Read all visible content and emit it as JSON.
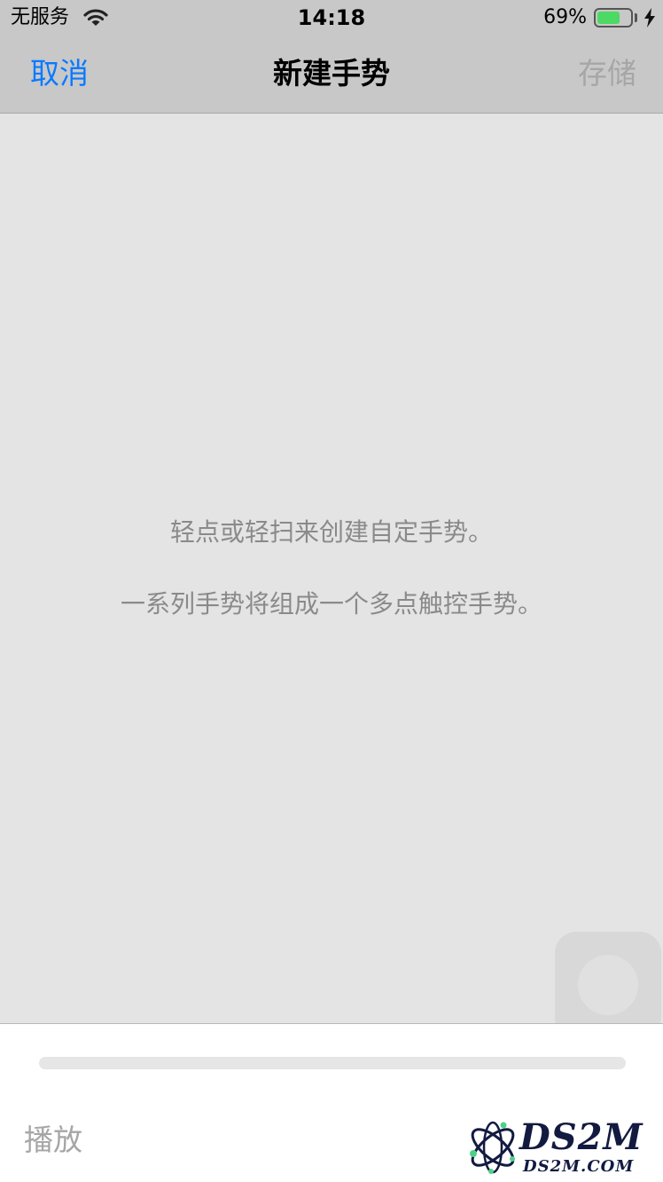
{
  "status_bar": {
    "carrier": "无服务",
    "time": "14:18",
    "battery_percent": "69%",
    "battery_level": 0.69,
    "icons": [
      "wifi-icon",
      "battery-icon",
      "charging-bolt-icon"
    ]
  },
  "nav": {
    "cancel_label": "取消",
    "title": "新建手势",
    "save_label": "存储"
  },
  "canvas": {
    "hint_line_1": "轻点或轻扫来创建自定手势。",
    "hint_line_2": "一系列手势将组成一个多点触控手势。"
  },
  "progress": {
    "value": 0
  },
  "toolbar": {
    "play_label": "播放"
  },
  "watermark": {
    "brand": "DS2M",
    "url": "DS2M.COM"
  },
  "colors": {
    "accent": "#0a7aff",
    "disabled": "#a6a6a6",
    "bar_background": "#c8c8c8",
    "canvas_background": "#e4e4e4",
    "battery_green": "#4cd964"
  }
}
